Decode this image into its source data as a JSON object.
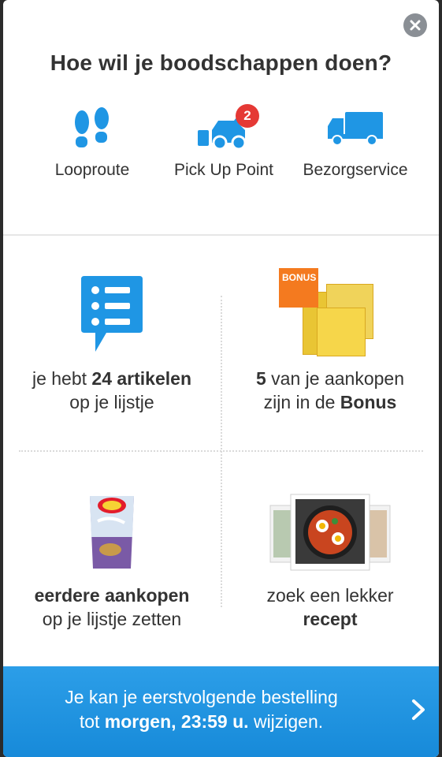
{
  "dialog": {
    "title": "Hoe wil je boodschappen doen?"
  },
  "options": [
    {
      "label": "Looproute",
      "icon": "footsteps-icon"
    },
    {
      "label": "Pick Up Point",
      "icon": "car-pickup-icon",
      "badge": "2"
    },
    {
      "label": "Bezorgservice",
      "icon": "delivery-truck-icon"
    }
  ],
  "tiles": {
    "list": {
      "prefix": "je hebt ",
      "bold": "24 artikelen",
      "line2": "op je lijstje"
    },
    "bonus": {
      "bold_num": "5",
      "line1_rest": " van je aankopen",
      "line2_prefix": "zijn in de ",
      "bold": "Bonus",
      "tag": "BONUS"
    },
    "previous": {
      "bold": "eerdere aankopen",
      "line2": "op je lijstje zetten"
    },
    "recipe": {
      "line1": "zoek een lekker",
      "bold": "recept"
    }
  },
  "footer": {
    "line1": "Je kan je eerstvolgende bestelling",
    "line2_prefix": "tot ",
    "line2_bold": "morgen, 23:59 u.",
    "line2_suffix": " wijzigen."
  },
  "colors": {
    "accent_blue": "#1f96e4",
    "badge_red": "#e53935",
    "bonus_orange": "#f47a1f"
  }
}
